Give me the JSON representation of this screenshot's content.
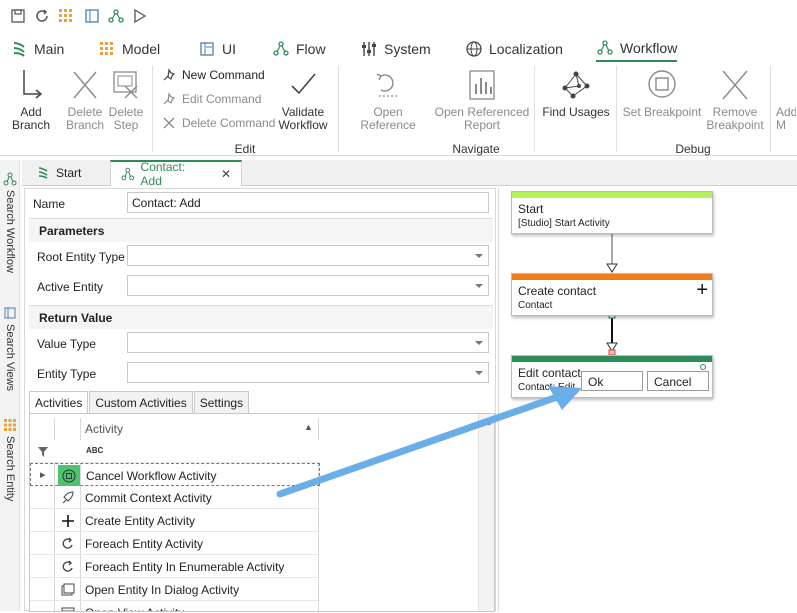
{
  "menu_tabs": [
    {
      "label": "Main",
      "icon": "main-tree-icon"
    },
    {
      "label": "Model",
      "icon": "model-grid-icon"
    },
    {
      "label": "UI",
      "icon": "ui-window-icon"
    },
    {
      "label": "Flow",
      "icon": "flow-icon"
    },
    {
      "label": "System",
      "icon": "system-sliders-icon"
    },
    {
      "label": "Localization",
      "icon": "globe-icon"
    },
    {
      "label": "Workflow",
      "icon": "workflow-icon"
    }
  ],
  "ribbon": {
    "add_branch": "Add Branch",
    "delete_branch": "Delete\nBranch",
    "delete_step": "Delete\nStep",
    "new_command": "New Command",
    "edit_command": "Edit Command",
    "delete_command": "Delete Command",
    "validate_workflow": "Validate\nWorkflow",
    "open_reference": "Open Reference",
    "open_referenced_report": "Open Referenced\nReport",
    "find_usages": "Find Usages",
    "set_breakpoint": "Set Breakpoint",
    "remove_breakpoint": "Remove\nBreakpoint",
    "add_truncated": "Add\nM",
    "group_edit": "Edit",
    "group_navigate": "Navigate",
    "group_debug": "Debug"
  },
  "rail": {
    "search_workflow": "Search Workflow",
    "search_views": "Search Views",
    "search_entity": "Search Entity"
  },
  "doc_tabs": {
    "start": "Start",
    "contact_add": "Contact: Add"
  },
  "props": {
    "name_label": "Name",
    "name_value": "Contact: Add",
    "parameters_head": "Parameters",
    "root_entity_type_label": "Root Entity Type",
    "active_entity_label": "Active Entity",
    "return_value_head": "Return Value",
    "value_type_label": "Value Type",
    "entity_type_label": "Entity Type"
  },
  "sub_tabs": [
    "Activities",
    "Custom Activities",
    "Settings"
  ],
  "grid": {
    "column_header": "Activity",
    "filter_glyph": "ABC",
    "rows": [
      {
        "label": "Cancel Workflow Activity",
        "icon": "cancel-workflow-icon"
      },
      {
        "label": "Commit Context Activity",
        "icon": "rocket-icon"
      },
      {
        "label": "Create Entity Activity",
        "icon": "plus-icon"
      },
      {
        "label": "Foreach Entity Activity",
        "icon": "loop-icon"
      },
      {
        "label": "Foreach Entity In Enumerable Activity",
        "icon": "loop-icon"
      },
      {
        "label": "Open Entity In Dialog Activity",
        "icon": "dialog-icon"
      },
      {
        "label": "Open View Activity",
        "icon": "view-icon"
      }
    ]
  },
  "canvas": {
    "nodes": [
      {
        "title": "Start",
        "subtitle": "[Studio] Start Activity",
        "color": "#b6f05a"
      },
      {
        "title": "Create contact",
        "subtitle": "Contact",
        "color": "#f07d1a"
      },
      {
        "title": "Edit contact",
        "subtitle": "Contact: Edit",
        "color": "#2e8b57"
      }
    ],
    "ok_label": "Ok",
    "cancel_label": "Cancel"
  },
  "colors": {
    "accent_green": "#2e8b57",
    "arrow_blue": "#6aaee8"
  }
}
